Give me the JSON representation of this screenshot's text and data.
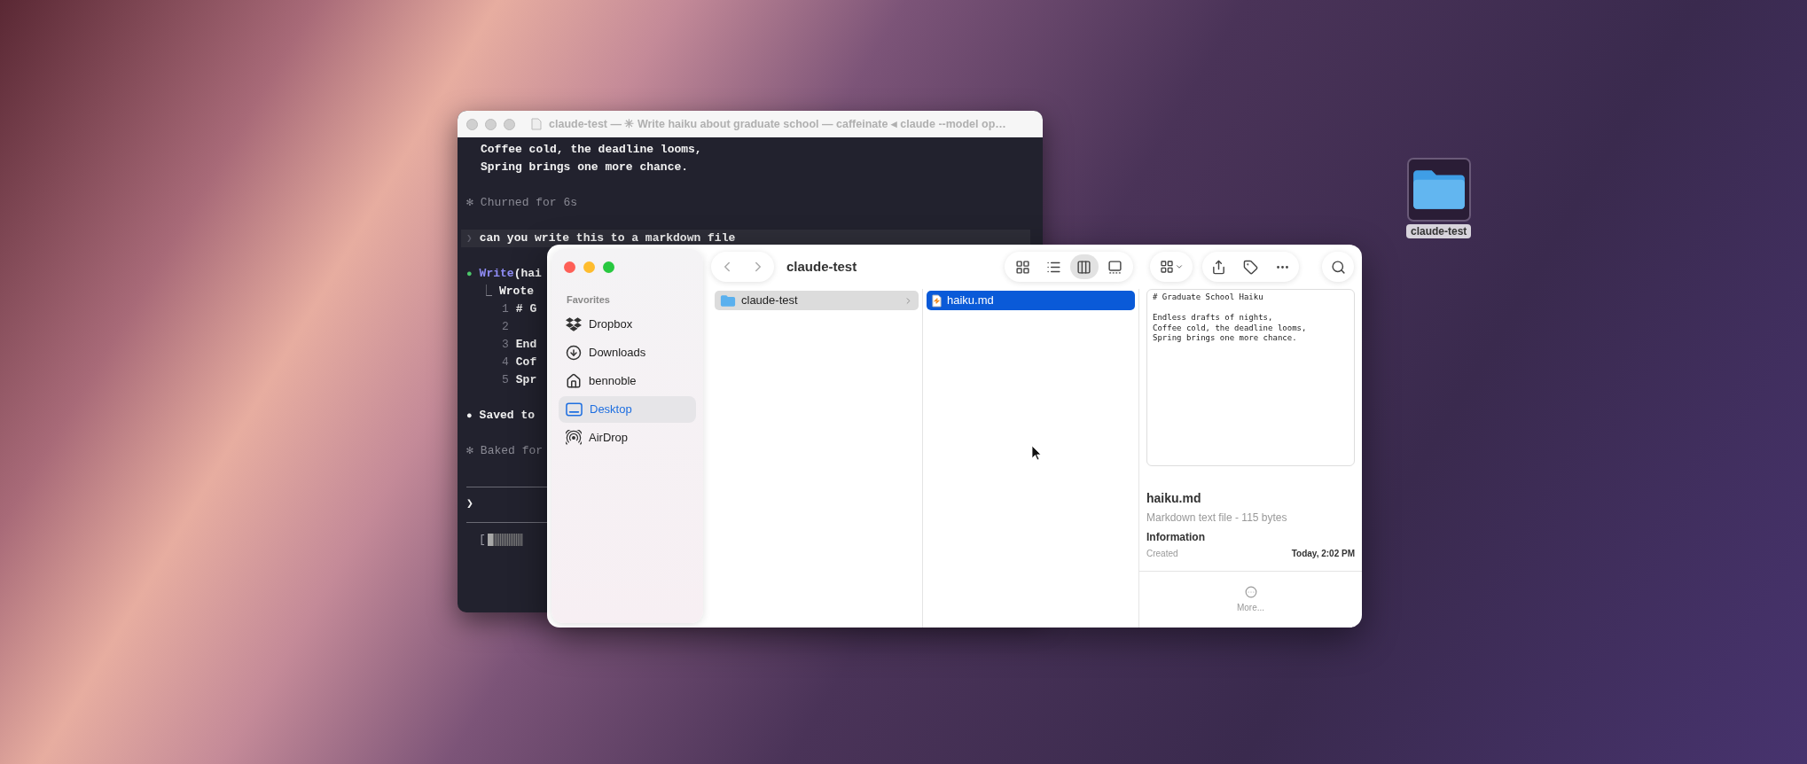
{
  "desktop_icon": {
    "label": "claude-test"
  },
  "terminal": {
    "title": "claude-test — ✳ Write haiku about graduate school — caffeinate ◂ claude --model op…",
    "lines": [
      {
        "kind": "text",
        "text": "Coffee cold, the deadline looms,"
      },
      {
        "kind": "text",
        "text": "Spring brings one more chance."
      },
      {
        "kind": "blank"
      },
      {
        "kind": "status",
        "marker": "✻",
        "text": "Churned for 6s"
      },
      {
        "kind": "blank"
      },
      {
        "kind": "prompt",
        "marker": "❯",
        "text": "can you write this to a markdown file"
      },
      {
        "kind": "blank"
      },
      {
        "kind": "tool",
        "marker": "●",
        "name": "Write",
        "text": "(hai"
      },
      {
        "kind": "result",
        "marker": "⎿",
        "text": "Wrote"
      },
      {
        "kind": "numbered",
        "number": "1",
        "text": "# G"
      },
      {
        "kind": "numbered",
        "number": "2"
      },
      {
        "kind": "numbered",
        "number": "3",
        "text": "End"
      },
      {
        "kind": "numbered",
        "number": "4",
        "text": "Cof"
      },
      {
        "kind": "numbered",
        "number": "5",
        "text": "Spr"
      },
      {
        "kind": "blank"
      },
      {
        "kind": "done",
        "marker": "●",
        "text": "Saved to"
      },
      {
        "kind": "blank"
      },
      {
        "kind": "status",
        "marker": "✻",
        "text": "Baked for"
      },
      {
        "kind": "blank"
      },
      {
        "kind": "rule"
      },
      {
        "kind": "input",
        "marker": "❯"
      },
      {
        "kind": "rule"
      },
      {
        "kind": "progress",
        "marker": "[",
        "level": 0.15
      }
    ]
  },
  "finder": {
    "title": "claude-test",
    "sidebar": {
      "heading": "Favorites",
      "items": [
        {
          "kind": "dropbox",
          "label": "Dropbox",
          "selected": false
        },
        {
          "kind": "downloads",
          "label": "Downloads",
          "selected": false
        },
        {
          "kind": "home",
          "label": "bennoble",
          "selected": false
        },
        {
          "kind": "desktop",
          "label": "Desktop",
          "selected": true
        },
        {
          "kind": "airdrop",
          "label": "AirDrop",
          "selected": false
        }
      ]
    },
    "views": [
      {
        "kind": "icons",
        "selected": false
      },
      {
        "kind": "list",
        "selected": false
      },
      {
        "kind": "columns",
        "selected": true
      },
      {
        "kind": "gallery",
        "selected": false
      }
    ],
    "columns": [
      {
        "items": [
          {
            "kind": "folder",
            "name": "claude-test",
            "selected": true
          }
        ]
      },
      {
        "items": [
          {
            "kind": "file",
            "name": "haiku.md",
            "selected": true
          }
        ]
      }
    ],
    "preview": {
      "content": [
        {
          "kind": "line",
          "text": "# Graduate School Haiku"
        },
        {
          "kind": "blank"
        },
        {
          "kind": "line",
          "text": "Endless drafts of nights,"
        },
        {
          "kind": "line",
          "text": "Coffee cold, the deadline looms,"
        },
        {
          "kind": "line",
          "text": "Spring brings one more chance."
        }
      ],
      "name": "haiku.md",
      "subtitle": "Markdown text file - 115 bytes",
      "section": "Information",
      "fields": [
        {
          "label": "Created",
          "value": "Today, 2:02 PM"
        }
      ],
      "more": "More..."
    }
  }
}
